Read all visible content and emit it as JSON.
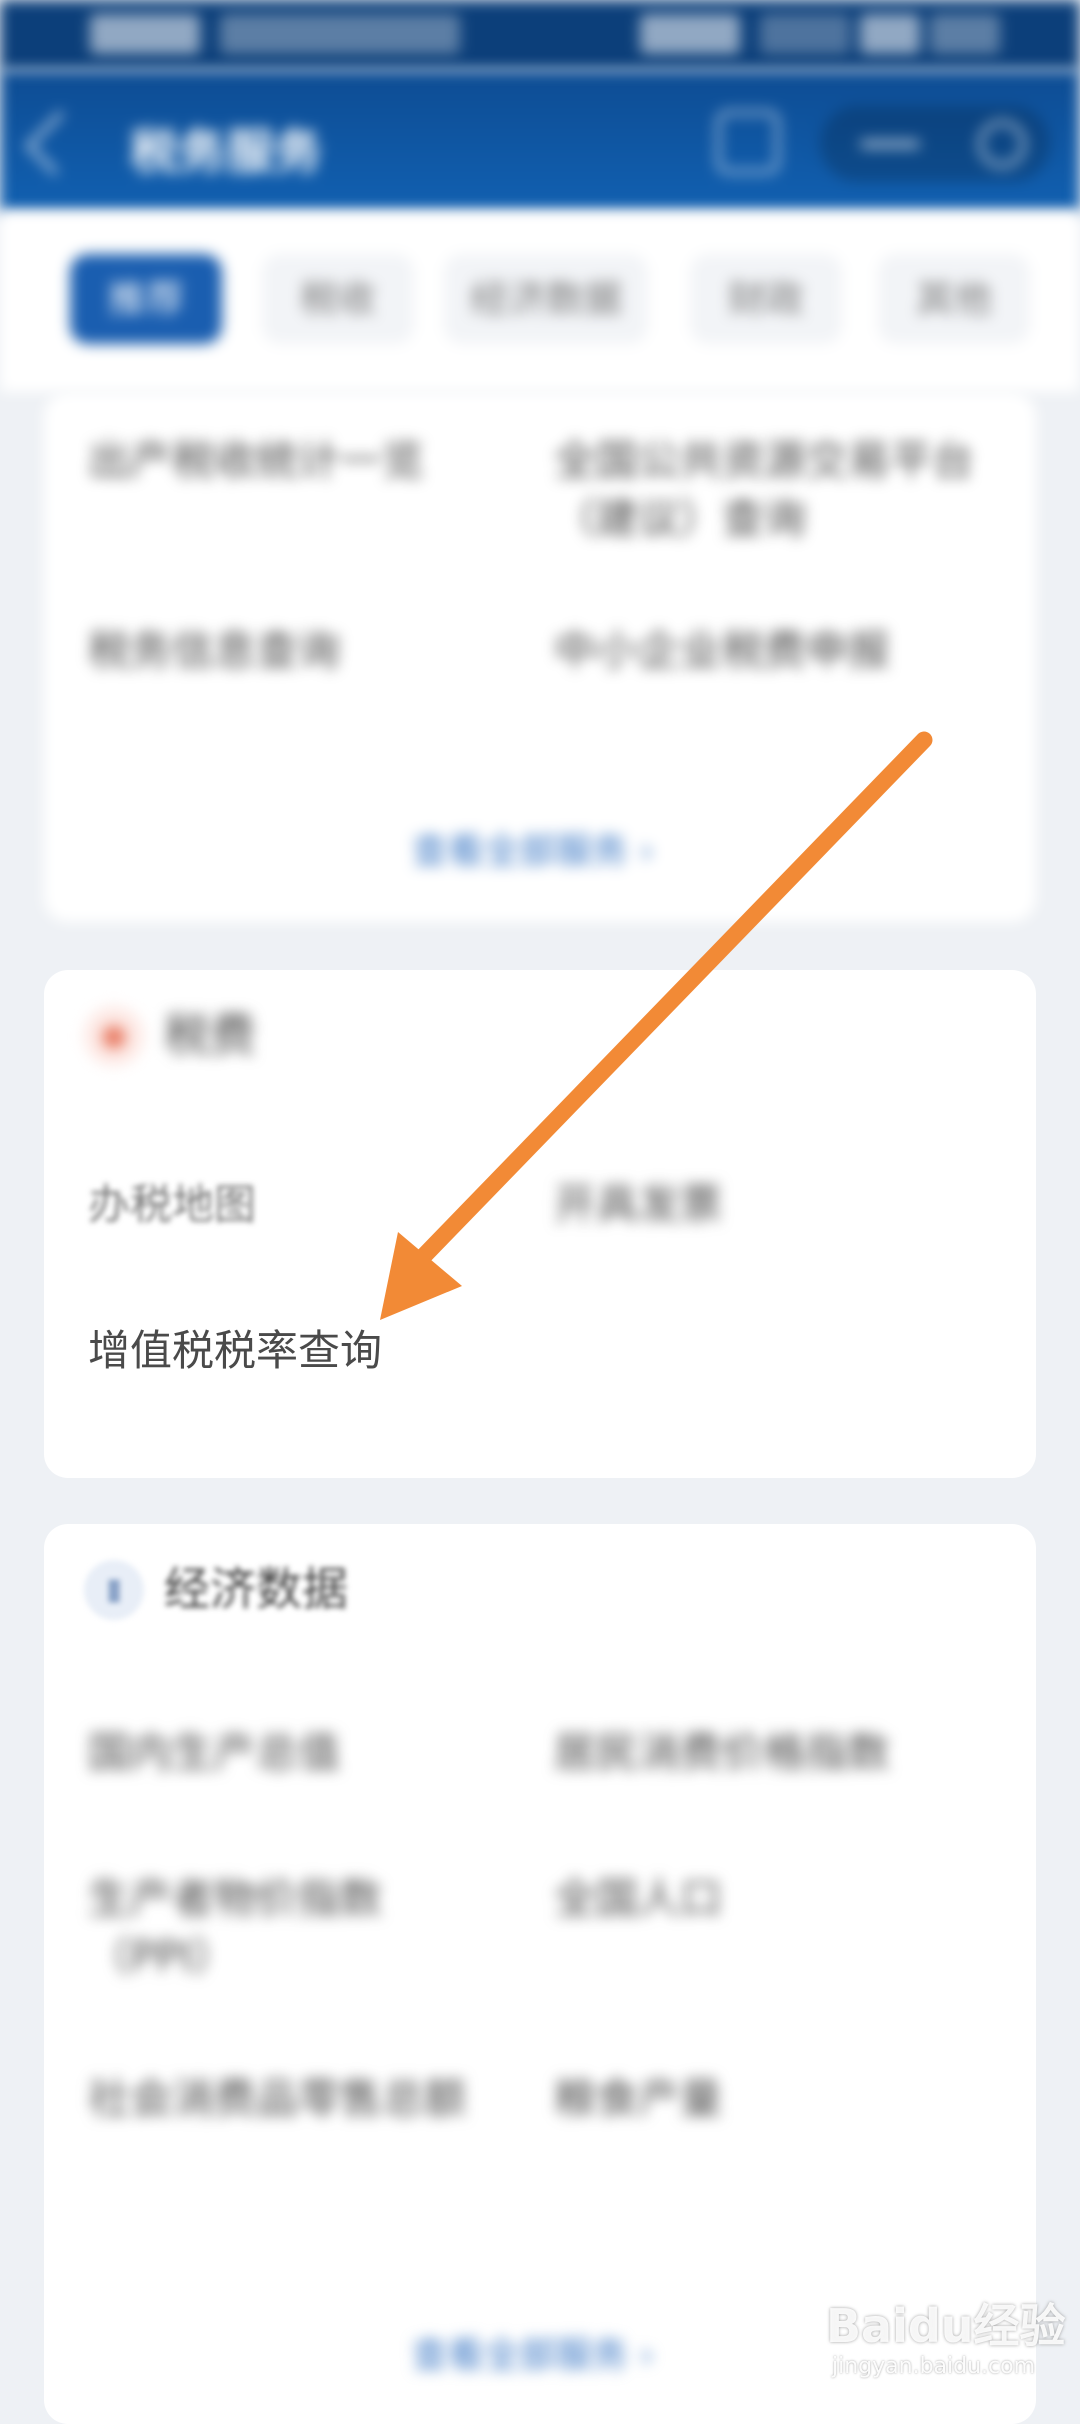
{
  "header": {
    "title": "税务服务",
    "menu_dots": "•••"
  },
  "tabs": [
    {
      "label": "推荐",
      "active": true
    },
    {
      "label": "税收"
    },
    {
      "label": "经济数据"
    },
    {
      "label": "财政"
    },
    {
      "label": "其他"
    }
  ],
  "top_card": {
    "items": [
      "出产税收统计一览",
      "全国公共资源交易平台（建议）查询",
      "税务信息查询",
      "中小企业税费申报"
    ],
    "more": "查看全部服务 ›"
  },
  "tax_section": {
    "title": "税费",
    "items": [
      "办税地图",
      "开具发票",
      "增值税税率查询"
    ]
  },
  "economy_section": {
    "title": "经济数据",
    "items": [
      "国内生产总值",
      "居民消费价格指数",
      "生产者物价指数（PPI）",
      "全国人口",
      "社会消费品零售总额",
      "粮食产量"
    ],
    "more": "查看全部服务 ›"
  },
  "watermark": {
    "main": "Baidu经验",
    "sub": "jingyan.baidu.com"
  },
  "colors": {
    "accent": "#1a5eb0",
    "annotation_arrow": "#f28a36"
  }
}
